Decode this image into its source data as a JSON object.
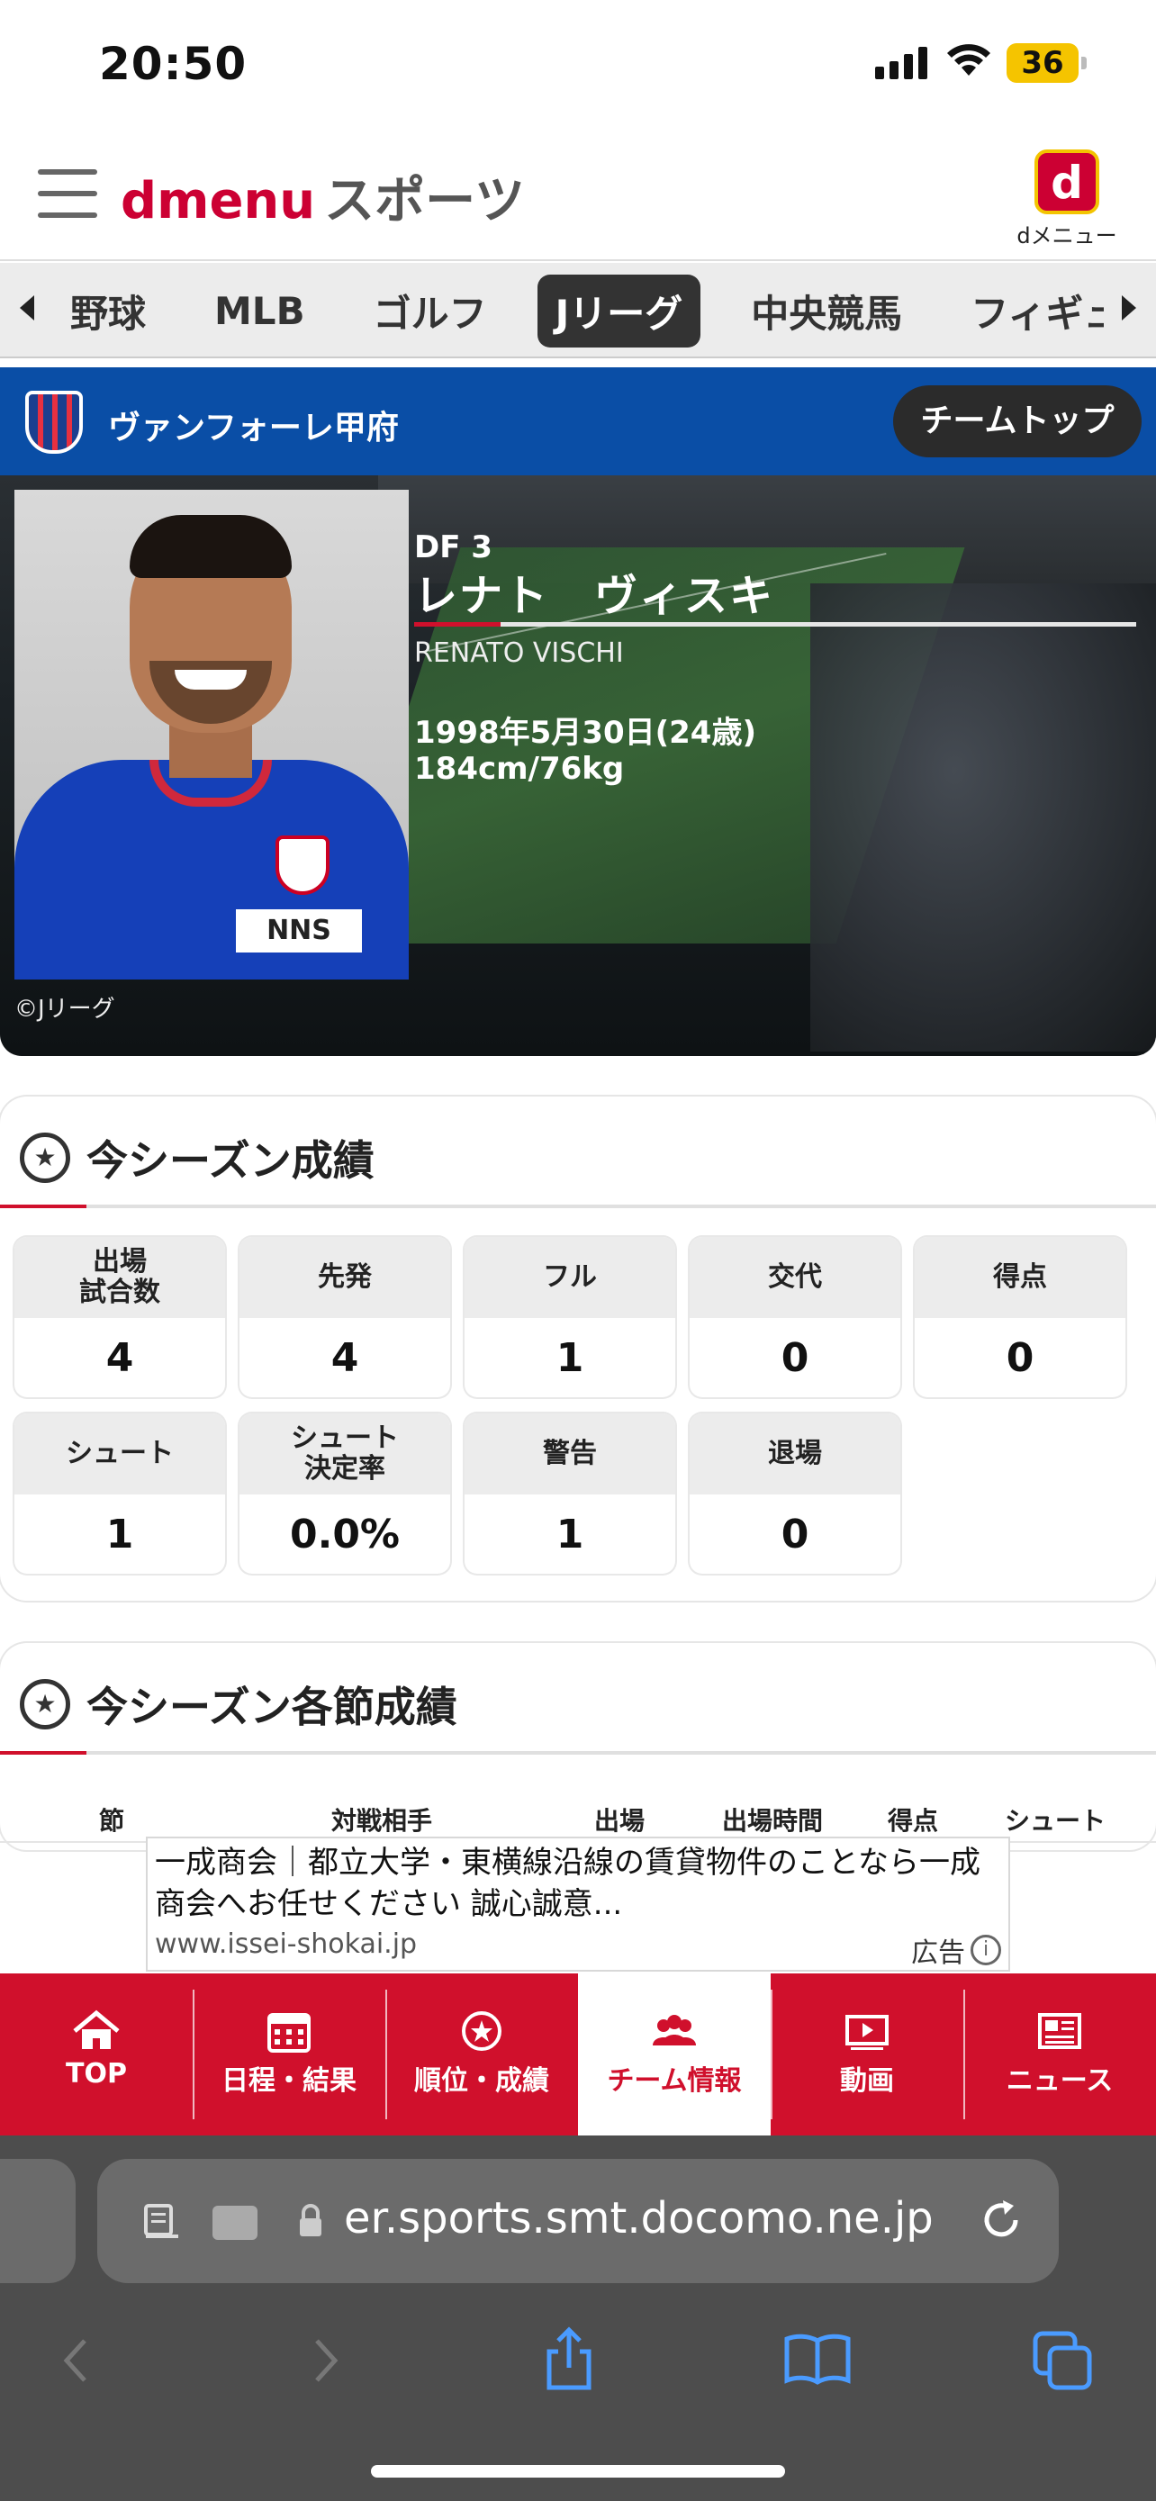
{
  "status_bar": {
    "time": "20:50",
    "battery": "36"
  },
  "header": {
    "logo_d": "d",
    "logo_menu": "menu",
    "logo_sports": "スポーツ",
    "app_icon_letter": "d",
    "app_label": "dメニュー"
  },
  "categories": [
    "野球",
    "MLB",
    "ゴルフ",
    "Jリーグ",
    "中央競馬",
    "フィギュア"
  ],
  "active_category": "Jリーグ",
  "team": {
    "name": "ヴァンフォーレ甲府",
    "top_button": "チームトップ"
  },
  "player": {
    "position": "DF 3",
    "name": "レナト　ヴィスキ",
    "name_en": "RENATO VISCHI",
    "birth": "1998年5月30日(24歳)",
    "body": "184cm/76kg",
    "photo_credit": "©Jリーグ",
    "sponsor": "NNS"
  },
  "season_stats": {
    "title": "今シーズン成績",
    "items": [
      {
        "label": "出場\n試合数",
        "value": "4"
      },
      {
        "label": "先発",
        "value": "4"
      },
      {
        "label": "フル",
        "value": "1"
      },
      {
        "label": "交代",
        "value": "0"
      },
      {
        "label": "得点",
        "value": "0"
      },
      {
        "label": "シュート",
        "value": "1"
      },
      {
        "label": "シュート\n決定率",
        "value": "0.0%"
      },
      {
        "label": "警告",
        "value": "1"
      },
      {
        "label": "退場",
        "value": "0"
      }
    ]
  },
  "match_stats": {
    "title": "今シーズン各節成績",
    "columns": [
      "節",
      "対戦相手",
      "出場",
      "出場時間",
      "得点",
      "シュート"
    ]
  },
  "ad": {
    "text": "一成商会｜都立大学・東横線沿線の賃貸物件のことなら一成商会へお任せください 誠心誠意...",
    "url": "www.issei-shokai.jp",
    "label": "広告",
    "info_glyph": "i"
  },
  "bottom_nav": [
    {
      "label": "TOP",
      "icon": "home-icon",
      "active": false
    },
    {
      "label": "日程・結果",
      "icon": "calendar-icon",
      "active": false
    },
    {
      "label": "順位・成績",
      "icon": "ranking-icon",
      "active": false
    },
    {
      "label": "チーム情報",
      "icon": "team-icon",
      "active": true
    },
    {
      "label": "動画",
      "icon": "video-icon",
      "active": false
    },
    {
      "label": "ニュース",
      "icon": "news-icon",
      "active": false
    }
  ],
  "browser": {
    "url": "er.sports.smt.docomo.ne.jp"
  },
  "colors": {
    "brand_red": "#d0102c",
    "team_blue": "#0a4ea6",
    "status_battery": "#f5c400"
  }
}
